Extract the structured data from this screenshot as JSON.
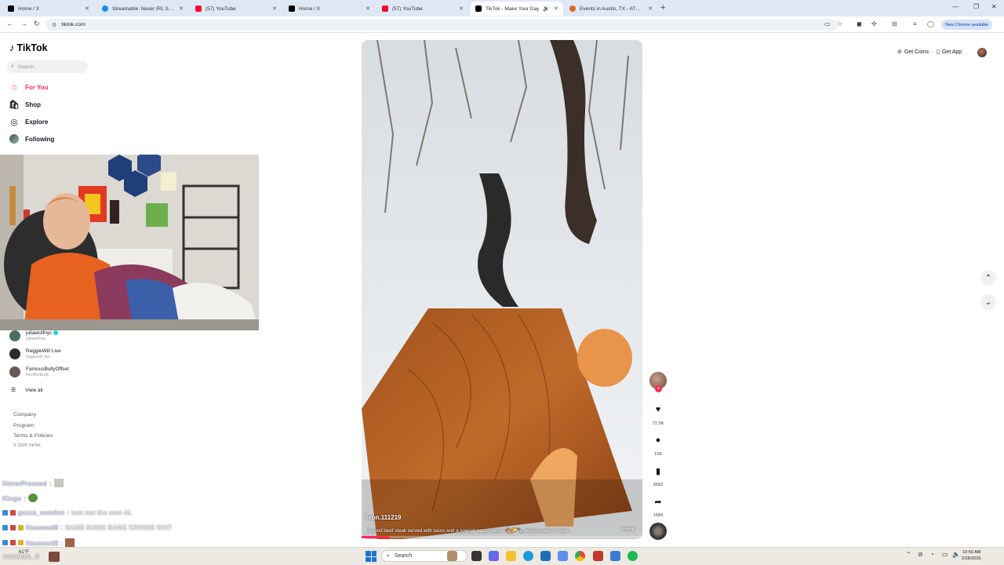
{
  "browser": {
    "tabs": [
      {
        "title": "Home / X",
        "favicon": "x-icon",
        "color": "#000000",
        "active": false
      },
      {
        "title": "Streamable: Never IRL Stream",
        "favicon": "streamable-icon",
        "color": "#0f90fa",
        "active": false
      },
      {
        "title": "(57) YouTube",
        "favicon": "youtube-icon",
        "color": "#ff0033",
        "active": false
      },
      {
        "title": "Home / X",
        "favicon": "x-icon",
        "color": "#000000",
        "active": false
      },
      {
        "title": "(57) YouTube",
        "favicon": "youtube-icon",
        "color": "#ff0033",
        "active": false
      },
      {
        "title": "TikTok - Make Your Day",
        "favicon": "tiktok-icon",
        "color": "#000000",
        "active": true
      },
      {
        "title": "Events in Austin, TX - ATXtoday",
        "favicon": "atx-icon",
        "color": "#e2661f",
        "active": false
      }
    ],
    "url": "tiktok.com",
    "chrome_update_label": "New Chrome available"
  },
  "tiktok": {
    "logo_text": "TikTok",
    "search_placeholder": "Search",
    "nav": [
      {
        "label": "For You",
        "icon": "home-icon",
        "active": true
      },
      {
        "label": "Shop",
        "icon": "shop-icon",
        "active": false
      },
      {
        "label": "Explore",
        "icon": "compass-icon",
        "active": false
      },
      {
        "label": "Following",
        "icon": "following-avatar-icon",
        "active": false
      }
    ],
    "following_accounts": [
      {
        "name": "juliawolfnyc",
        "handle": "juliawolfnyc",
        "verified": true
      },
      {
        "name": "ReggieWill Live",
        "handle": "reggiewill_live",
        "verified": false
      },
      {
        "name": "FamousBullyOffset",
        "handle": "theoffsetbully",
        "verified": false
      }
    ],
    "view_all_label": "View all",
    "footer_links": [
      "Company",
      "Program",
      "Terms & Policies"
    ],
    "copyright": "© 2026 TikTok",
    "top_right": {
      "get_coins": "Get Coins",
      "get_app": "Get App"
    },
    "video": {
      "author": "leon.111219",
      "description": "Ground beef steak served with tacos and a special sauce recipe 🍖🌮🔪 #cookingasmr #leon...",
      "more_label": "more",
      "progress": 0.1,
      "likes": "72.5K",
      "comments": "196",
      "saves": "3582",
      "shares": "1684"
    }
  },
  "stream_chat": [
    {
      "user": "NeverPressed",
      "message": "",
      "badges": [],
      "emote": true
    },
    {
      "user": "Kingo",
      "message": "",
      "badges": [],
      "emote": true
    },
    {
      "user": "gazza_sweden",
      "message": "test out the new AI.",
      "badges": [
        "blue",
        "red"
      ],
      "emote": false
    },
    {
      "user": "Nausoud8",
      "message": "SAME SONG SAME CRINGE SHIT",
      "badges": [
        "blue",
        "red",
        "gold"
      ],
      "emote": false
    },
    {
      "user": "Nausoud8",
      "message": "",
      "badges": [
        "blue",
        "red",
        "gold"
      ],
      "emote": true
    }
  ],
  "taskbar": {
    "weather_temp": "61°F",
    "overlay_user": "norman_d",
    "search_label": "Search",
    "time": "10:50 AM",
    "date": "2/28/2026"
  }
}
